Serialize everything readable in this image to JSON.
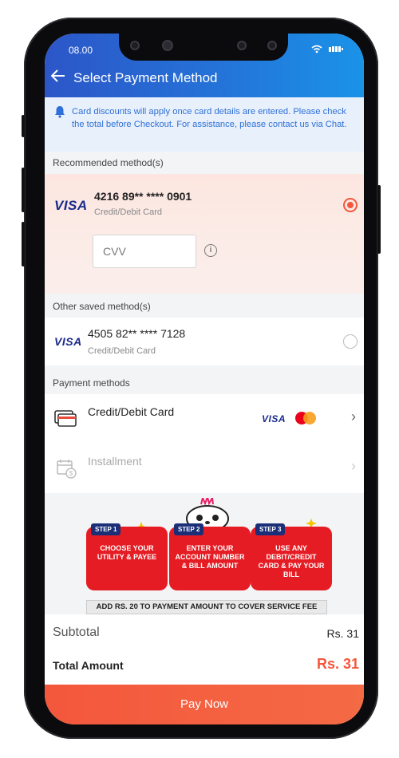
{
  "status": {
    "time": "08.00",
    "icons": [
      "wifi-icon",
      "battery-icon"
    ]
  },
  "header": {
    "back_icon": "back-arrow-icon",
    "title": "Select Payment Method"
  },
  "notice": {
    "icon": "bell-icon",
    "text": "Card discounts will apply once card details are entered. Please check the total before Checkout. For assistance, please contact us via Chat."
  },
  "recommended": {
    "label": "Recommended method(s)",
    "brand": "VISA",
    "card_number": "4216 89** **** 0901",
    "card_type": "Credit/Debit Card",
    "cvv_placeholder": "CVV",
    "selected": true
  },
  "other_saved": {
    "label": "Other saved method(s)",
    "brand": "VISA",
    "card_number": "4505 82** **** 7128",
    "card_type": "Credit/Debit Card",
    "selected": false
  },
  "payment_methods": {
    "label": "Payment methods",
    "items": [
      {
        "label": "Credit/Debit Card",
        "icon": "credit-card-icon",
        "brands": [
          "VISA",
          "mastercard"
        ],
        "enabled": true
      },
      {
        "label": "Installment",
        "icon": "calendar-installment-icon",
        "enabled": false
      }
    ]
  },
  "banner": {
    "steps": [
      {
        "tag": "STEP 1",
        "text": "CHOOSE YOUR UTILITY & PAYEE"
      },
      {
        "tag": "STEP 2",
        "text": "ENTER YOUR ACCOUNT NUMBER & BILL AMOUNT"
      },
      {
        "tag": "STEP 3",
        "text": "USE ANY DEBIT/CREDIT CARD & PAY YOUR BILL"
      }
    ],
    "fee_note": "ADD RS. 20 TO PAYMENT AMOUNT TO COVER SERVICE FEE"
  },
  "totals": {
    "subtotal_label": "Subtotal",
    "subtotal_value": "Rs. 31",
    "total_label": "Total Amount",
    "total_value": "Rs. 31"
  },
  "pay_button": "Pay Now",
  "colors": {
    "header_gradient": [
      "#2c56c8",
      "#1a93e8"
    ],
    "accent": "#f4573c",
    "visa_blue": "#1a2a8c",
    "notice_text": "#2f6fd8"
  }
}
